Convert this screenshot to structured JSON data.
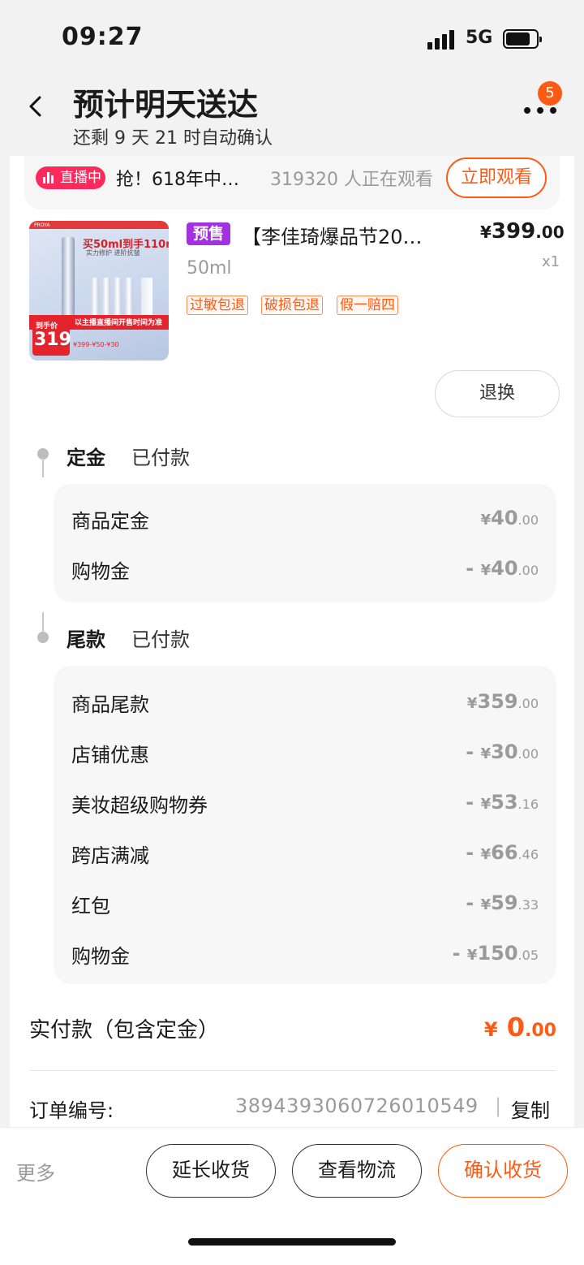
{
  "status_bar": {
    "time": "09:27",
    "network": "5G",
    "battery_level": 0.8
  },
  "header": {
    "title": "预计明天送达",
    "subtitle": "还剩 9 天 21 时自动确认",
    "badge_count": "5"
  },
  "live": {
    "badge_label": "直播中",
    "text": "抢！618年中…",
    "viewers": "319320 人正在观看",
    "watch_label": "立即观看"
  },
  "product": {
    "image": {
      "brand": "PROYA",
      "headline": "买50ml到手110ml",
      "subline": "实力修护 进阶抗皱",
      "banner": "以主播直播间开售时间为准",
      "tag_label": "到手价",
      "price": "319",
      "footnote": "¥399-¥50-¥30"
    },
    "presale_tag": "预售",
    "title": "【李佳琦爆品节20…",
    "price_currency": "¥",
    "price_int": "399",
    "price_dec": ".00",
    "variant": "50ml",
    "quantity": "x1",
    "service_tags": [
      "过敏包退",
      "破损包退",
      "假一赔四"
    ]
  },
  "return_button": "退换",
  "deposit": {
    "name": "定金",
    "status": "已付款",
    "rows": [
      {
        "label": "商品定金",
        "prefix": "",
        "currency": "¥",
        "int": "40",
        "dec": ".00"
      },
      {
        "label": "购物金",
        "prefix": "- ",
        "currency": "¥",
        "int": "40",
        "dec": ".00"
      }
    ]
  },
  "balance": {
    "name": "尾款",
    "status": "已付款",
    "rows": [
      {
        "label": "商品尾款",
        "prefix": "",
        "currency": "¥",
        "int": "359",
        "dec": ".00"
      },
      {
        "label": "店铺优惠",
        "prefix": "- ",
        "currency": "¥",
        "int": "30",
        "dec": ".00"
      },
      {
        "label": "美妆超级购物券",
        "prefix": "- ",
        "currency": "¥",
        "int": "53",
        "dec": ".16"
      },
      {
        "label": "跨店满减",
        "prefix": "- ",
        "currency": "¥",
        "int": "66",
        "dec": ".46"
      },
      {
        "label": "红包",
        "prefix": "- ",
        "currency": "¥",
        "int": "59",
        "dec": ".33"
      },
      {
        "label": "购物金",
        "prefix": "- ",
        "currency": "¥",
        "int": "150",
        "dec": ".05"
      }
    ]
  },
  "paid": {
    "label": "实付款（包含定金）",
    "currency": "¥",
    "int": "0",
    "dec": ".00"
  },
  "order": {
    "label": "订单编号:",
    "number": "3894393060726010549",
    "separator": "|",
    "copy_label": "复制"
  },
  "bottom_bar": {
    "more_label": "更多",
    "extend_label": "延长收货",
    "logistics_label": "查看物流",
    "confirm_label": "确认收货"
  },
  "colors": {
    "accent": "#ff5a14",
    "live": "#ff2a5c",
    "presale": "#a431e0",
    "background": "#f2f2f2"
  },
  "icons": [
    "back-icon",
    "more-icon",
    "signal-icon",
    "battery-icon",
    "live-icon"
  ]
}
